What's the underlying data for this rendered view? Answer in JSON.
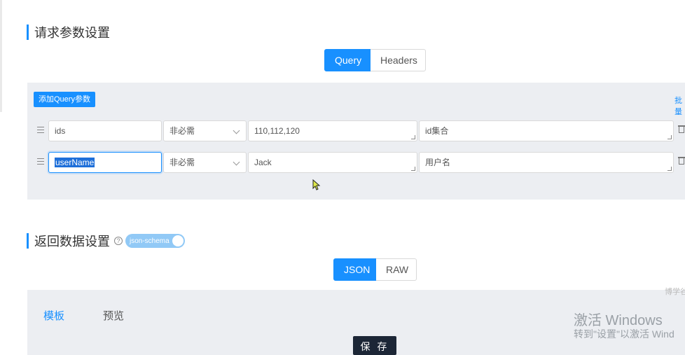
{
  "request": {
    "title": "请求参数设置",
    "tabs": [
      {
        "label": "Query",
        "active": true
      },
      {
        "label": "Headers",
        "active": false
      }
    ],
    "add_button": "添加Query参数",
    "batch_link": "批量",
    "rows": [
      {
        "name": "ids",
        "required": "非必需",
        "example": "110,112,120",
        "description": "id集合"
      },
      {
        "name": "userName",
        "required": "非必需",
        "example": "Jack",
        "description": "用户名"
      }
    ]
  },
  "response": {
    "title": "返回数据设置",
    "help": "?",
    "switch_label": "json-schema",
    "tabs": [
      {
        "label": "JSON",
        "active": true
      },
      {
        "label": "RAW",
        "active": false
      }
    ],
    "subtabs": [
      {
        "label": "模板",
        "active": true
      },
      {
        "label": "预览",
        "active": false
      }
    ],
    "save_button": "保 存"
  },
  "overlay": {
    "activate_title": "激活 Windows",
    "activate_sub": "转到\"设置\"以激活 Wind",
    "corner": "博学谷"
  },
  "colors": {
    "accent": "#1890ff",
    "panel_bg": "#eceef2",
    "save_bg": "#1c2636"
  }
}
